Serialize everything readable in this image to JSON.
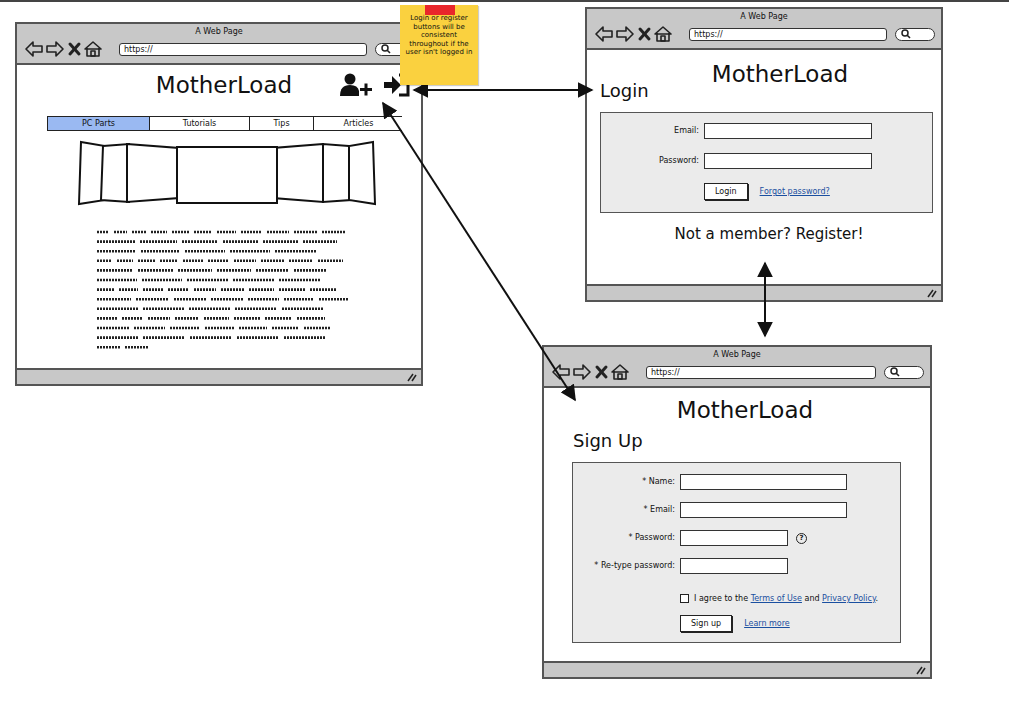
{
  "note": {
    "text": "Login or register buttons will be consistent throughout if the user isn't logged in"
  },
  "home": {
    "window": {
      "title": "A Web Page",
      "url": "https://"
    },
    "logo": "MotherLoad",
    "tabs": [
      {
        "label": "PC Parts",
        "selected": true
      },
      {
        "label": "Tutorials",
        "selected": false
      },
      {
        "label": "Tips",
        "selected": false
      },
      {
        "label": "Articles",
        "selected": false
      }
    ]
  },
  "login": {
    "window": {
      "title": "A Web Page",
      "url": "https://"
    },
    "logo": "MotherLoad",
    "heading": "Login",
    "fields": [
      {
        "label": "Email:",
        "kind": "text"
      },
      {
        "label": "Password:",
        "kind": "password"
      }
    ],
    "button": "Login",
    "link": "Forgot password?",
    "register": "Not a member? Register!"
  },
  "signup": {
    "window": {
      "title": "A Web Page",
      "url": "https://"
    },
    "logo": "MotherLoad",
    "heading": "Sign Up",
    "fields": [
      {
        "label": "* Name:",
        "kind": "text"
      },
      {
        "label": "* Email:",
        "kind": "text"
      },
      {
        "label": "* Password:",
        "kind": "password",
        "help": "?"
      },
      {
        "label": "* Re-type password:",
        "kind": "password"
      }
    ],
    "agree": {
      "checked": false,
      "parts": [
        {
          "text": "I agree to the ",
          "link": false
        },
        {
          "text": "Terms of Use",
          "link": true
        },
        {
          "text": " and ",
          "link": false
        },
        {
          "text": "Privacy Policy",
          "link": true
        },
        {
          "text": ".",
          "link": false
        }
      ]
    },
    "button": "Sign up",
    "link": "Learn more"
  }
}
